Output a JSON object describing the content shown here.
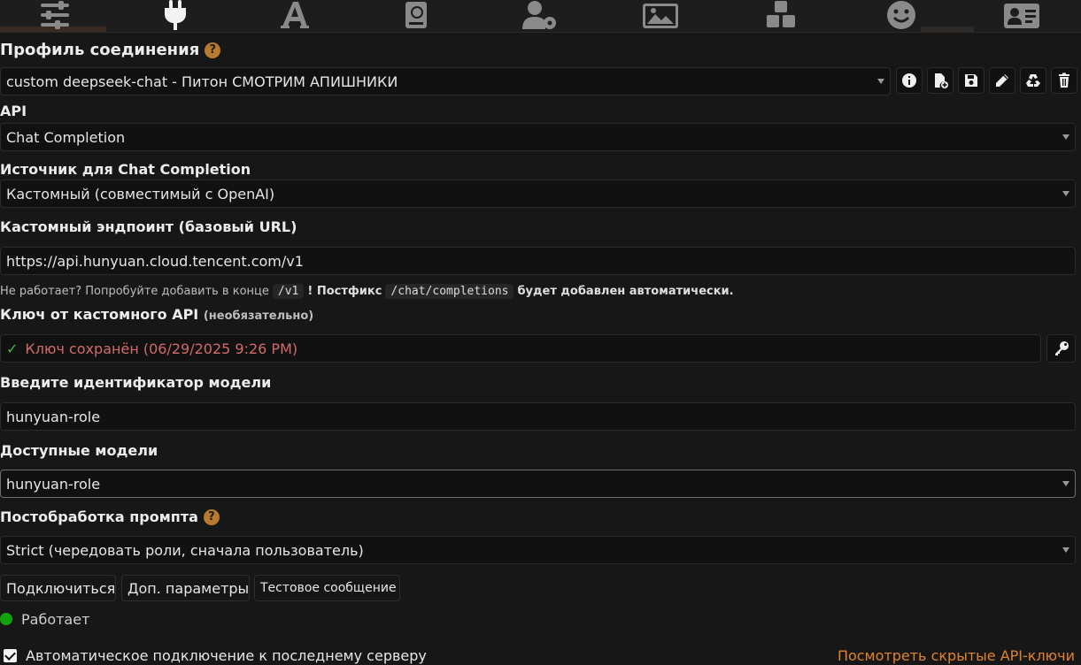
{
  "connection_profile": {
    "label": "Профиль соединения",
    "help_glyph": "?",
    "selected": "custom deepseek-chat - Питон СМОТРИМ АПИШНИКИ"
  },
  "api": {
    "label": "API",
    "selected": "Chat Completion"
  },
  "source": {
    "label": "Источник для Chat Completion",
    "selected": "Кастомный (совместимый с OpenAI)"
  },
  "endpoint": {
    "label": "Кастомный эндпоинт (базовый URL)",
    "value": "https://api.hunyuan.cloud.tencent.com/v1",
    "hint_prefix": "Не работает? Попробуйте добавить в конце",
    "hint_code_1": "/v1",
    "hint_mid": "! Постфикс",
    "hint_code_2": "/chat/completions",
    "hint_suffix": "будет добавлен автоматически."
  },
  "api_key": {
    "label": "Ключ от кастомного API",
    "label_note": "(необязательно)",
    "check_glyph": "✓",
    "status": "Ключ сохранён (06/29/2025 9:26 PM)"
  },
  "model_id": {
    "label": "Введите идентификатор модели",
    "value": "hunyuan-role"
  },
  "available_models": {
    "label": "Доступные модели",
    "selected": "hunyuan-role"
  },
  "postprocess": {
    "label": "Постобработка промпта",
    "help_glyph": "?",
    "selected": "Strict (чередовать роли, сначала пользователь)"
  },
  "buttons": {
    "connect": "Подключиться",
    "advanced": "Доп. параметры",
    "test_message": "Тестовое сообщение"
  },
  "status": {
    "text": "Работает",
    "color": "#13a10e"
  },
  "auto_connect": {
    "label": "Автоматическое подключение к последнему серверу",
    "checked": true
  },
  "hidden_keys_link": "Посмотреть скрытые API-ключи",
  "colors": {
    "accent_help": "#b87a2e",
    "link": "#e0822a",
    "key_saved": "#d36a6a",
    "check": "#3fbf4a"
  },
  "icons": {
    "top_nav": [
      "sliders-icon",
      "plug-icon",
      "font-icon",
      "book-atlas-icon",
      "user-gear-icon",
      "image-icon",
      "cubes-icon",
      "smile-icon",
      "id-card-icon"
    ],
    "profile_actions": [
      "info-icon",
      "file-add-icon",
      "save-icon",
      "pencil-icon",
      "recycle-icon",
      "trash-icon"
    ]
  }
}
